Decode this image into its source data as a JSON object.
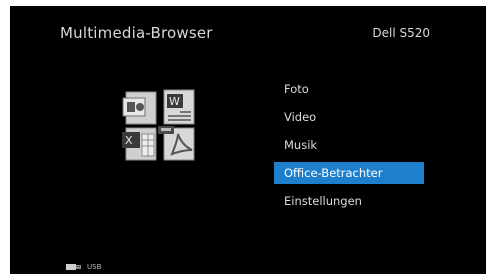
{
  "header": {
    "title": "Multimedia-Browser",
    "device": "Dell S520"
  },
  "menu": {
    "items": [
      {
        "label": "Foto",
        "selected": false
      },
      {
        "label": "Video",
        "selected": false
      },
      {
        "label": "Musik",
        "selected": false
      },
      {
        "label": "Office-Betrachter",
        "selected": true
      },
      {
        "label": "Einstellungen",
        "selected": false
      }
    ],
    "selected_color": "#1e7fcc"
  },
  "icons": {
    "main": "office-documents-icon",
    "source": "usb-drive-icon"
  },
  "status": {
    "source_label": "USB"
  }
}
